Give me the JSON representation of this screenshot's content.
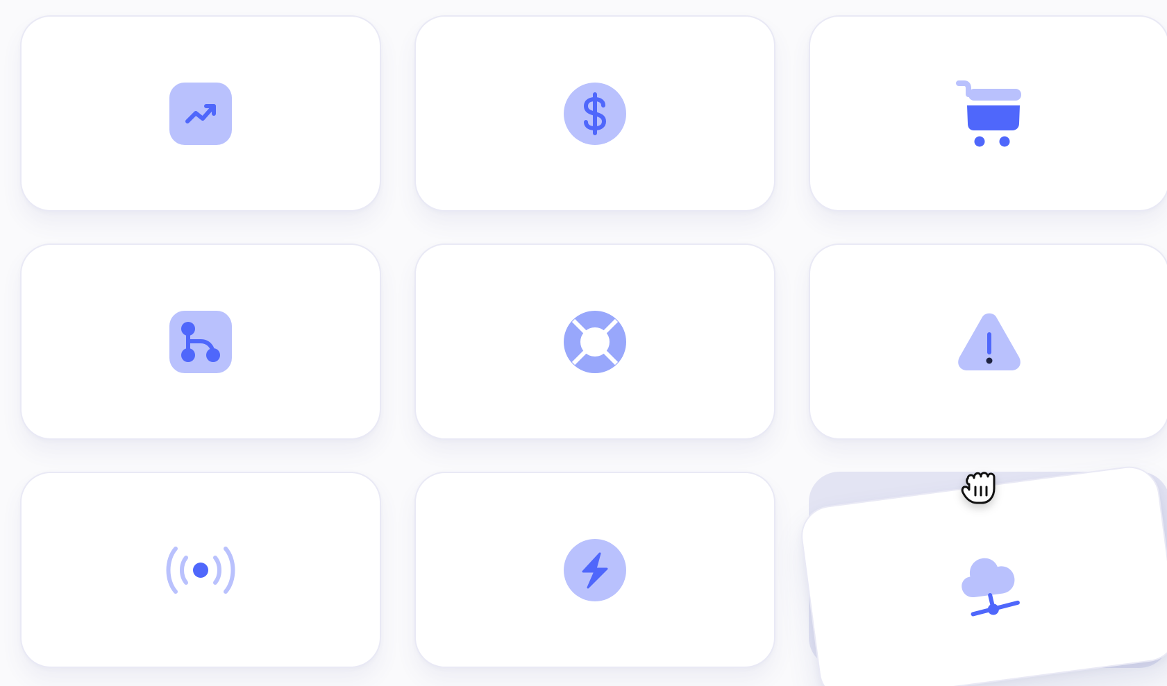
{
  "colors": {
    "icon_primary": "#4f67fb",
    "icon_secondary": "#b9c1fd",
    "icon_mid": "#98a7fb",
    "card_background": "#ffffff",
    "card_border": "#e9e9f5",
    "placeholder": "#e3e4f3"
  },
  "cards": [
    {
      "icon": "trending-up-icon"
    },
    {
      "icon": "dollar-coin-icon"
    },
    {
      "icon": "shopping-cart-icon"
    },
    {
      "icon": "git-branch-icon"
    },
    {
      "icon": "lifebuoy-icon"
    },
    {
      "icon": "warning-triangle-icon"
    },
    {
      "icon": "broadcast-icon"
    },
    {
      "icon": "lightning-bolt-icon"
    },
    {
      "icon": "cloud-network-icon"
    }
  ],
  "drag": {
    "dragging_card": "cloud-network-icon",
    "cursor": "grabbing-hand-icon"
  }
}
